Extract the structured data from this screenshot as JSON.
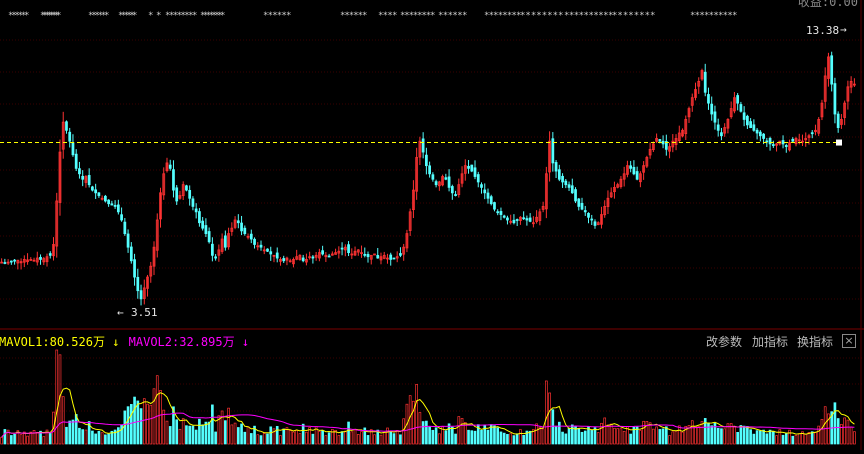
{
  "header": {
    "corner_label": "收益:0.00"
  },
  "chart_data": {
    "type": "candlestick",
    "price_panel": {
      "ylim": [
        2.6,
        14.3
      ],
      "reference_price": 9.35,
      "max_label": "13.38",
      "min_label": "3.51",
      "max_value": 13.38,
      "min_value": 3.51,
      "event_marker_count": 118
    },
    "volume_panel": {
      "indicators": [
        {
          "name": "MAVOL1",
          "value": "80.526万",
          "color": "#ffff00",
          "arrow": "↓"
        },
        {
          "name": "MAVOL2",
          "value": "32.895万",
          "color": "#ff00ff",
          "arrow": "↓"
        }
      ],
      "buttons": [
        "改参数",
        "加指标",
        "换指标"
      ],
      "close_label": "×"
    },
    "colors": {
      "up": "#ff3232",
      "down": "#54ffff",
      "reference_line": "#ffff00",
      "mavol1": "#ffff00",
      "mavol2": "#ff00ff",
      "grid": "#3a0000"
    },
    "closes": [
      4.95,
      4.9,
      4.95,
      4.98,
      5.0,
      5.02,
      4.97,
      5.05,
      5.03,
      5.05,
      5.02,
      5.1,
      5.05,
      5.08,
      5.15,
      5.2,
      5.6,
      7.2,
      9.0,
      10.1,
      9.8,
      9.4,
      8.9,
      8.4,
      8.2,
      8.0,
      8.1,
      7.8,
      7.6,
      7.5,
      7.4,
      7.3,
      7.2,
      7.1,
      7.05,
      7.0,
      6.8,
      6.5,
      6.0,
      5.5,
      5.0,
      4.4,
      3.9,
      3.6,
      4.0,
      4.4,
      4.8,
      5.5,
      6.5,
      7.5,
      8.2,
      8.6,
      8.4,
      7.6,
      7.2,
      7.4,
      7.8,
      7.6,
      7.3,
      7.0,
      6.8,
      6.4,
      6.2,
      6.0,
      5.7,
      5.2,
      5.1,
      5.4,
      5.8,
      5.5,
      6.0,
      6.2,
      6.5,
      6.4,
      6.1,
      6.0,
      5.9,
      5.8,
      5.6,
      5.55,
      5.5,
      5.4,
      5.35,
      5.25,
      5.2,
      5.1,
      5.05,
      5.0,
      5.1,
      5.0,
      5.05,
      5.15,
      5.2,
      5.0,
      5.05,
      5.15,
      5.1,
      5.2,
      5.3,
      5.25,
      5.2,
      5.15,
      5.25,
      5.3,
      5.35,
      5.45,
      5.5,
      5.3,
      5.25,
      5.35,
      5.4,
      5.3,
      5.2,
      5.15,
      5.2,
      5.25,
      5.1,
      5.15,
      5.2,
      5.1,
      5.05,
      5.1,
      5.15,
      5.2,
      5.5,
      6.0,
      6.8,
      7.6,
      8.8,
      9.4,
      9.0,
      8.5,
      8.2,
      8.0,
      7.8,
      7.9,
      8.1,
      8.0,
      7.7,
      7.5,
      7.4,
      7.8,
      8.2,
      8.5,
      8.4,
      8.3,
      8.1,
      7.9,
      7.7,
      7.5,
      7.3,
      7.1,
      6.9,
      6.8,
      6.7,
      6.6,
      6.5,
      6.45,
      6.4,
      6.5,
      6.6,
      6.55,
      6.5,
      6.45,
      6.4,
      6.6,
      6.8,
      7.0,
      8.2,
      9.4,
      8.6,
      8.3,
      8.0,
      7.9,
      7.8,
      7.7,
      7.5,
      7.2,
      7.0,
      6.9,
      6.8,
      6.6,
      6.5,
      6.3,
      6.4,
      6.7,
      7.0,
      7.3,
      7.5,
      7.7,
      7.8,
      8.0,
      8.2,
      8.5,
      8.4,
      8.2,
      8.0,
      8.2,
      8.5,
      8.8,
      9.1,
      9.3,
      9.5,
      9.4,
      9.3,
      9.1,
      9.2,
      9.4,
      9.5,
      9.7,
      9.8,
      10.2,
      10.6,
      11.0,
      11.3,
      11.6,
      12.0,
      11.2,
      10.8,
      10.4,
      10.1,
      9.8,
      9.6,
      9.9,
      10.2,
      10.6,
      11.0,
      10.8,
      10.5,
      10.2,
      10.0,
      9.9,
      9.8,
      9.7,
      9.6,
      9.5,
      9.4,
      9.3,
      9.25,
      9.3,
      9.4,
      9.3,
      9.2,
      9.35,
      9.4,
      9.5,
      9.45,
      9.4,
      9.5,
      9.6,
      9.7,
      9.8,
      10.2,
      10.8,
      11.8,
      12.5,
      11.5,
      10.4,
      9.9,
      10.2,
      10.8,
      11.4,
      11.6,
      11.5
    ]
  }
}
